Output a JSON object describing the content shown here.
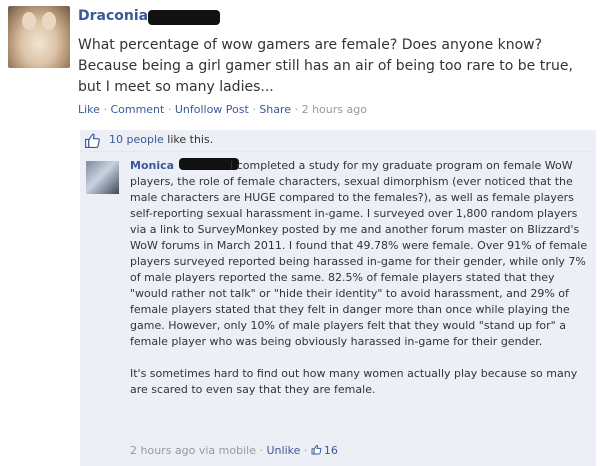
{
  "post": {
    "author": "Draconia",
    "text": "What percentage of wow gamers are female? Does anyone know? Because being a girl gamer still has an air of being too rare to be true, but I meet so many ladies...",
    "actions": {
      "like": "Like",
      "comment": "Comment",
      "unfollow": "Unfollow Post",
      "share": "Share",
      "time": "2 hours ago",
      "separator": "·"
    }
  },
  "likes": {
    "icon": "thumbs-up-icon",
    "count_text": "10 people",
    "suffix": " like this."
  },
  "comment": {
    "author": "Monica",
    "text": "I completed a study for my graduate program on female WoW players, the role of female characters, sexual dimorphism (ever noticed that the male characters are HUGE compared to the females?), as well as female players self-reporting sexual harassment in-game. I surveyed over 1,800 random players via a link to SurveyMonkey posted by me and another forum master on Blizzard's WoW forums in March 2011. I found that 49.78% were female. Over 91% of female players surveyed reported being harassed in-game for their gender, while only 7% of male players reported the same. 82.5% of female players stated that they \"would rather not talk\" or \"hide their identity\" to avoid harassment, and 29% of female players stated that they felt in danger more than once while playing the game. However, only 10% of male players felt that they would \"stand up for\" a female player who was being obviously harassed in-game for their gender.",
    "text2": "It's sometimes hard to find out how many women actually play because so many are scared to even say that they are female.",
    "time": "2 hours ago via mobile",
    "separator": "·",
    "unlike": "Unlike",
    "like_count": "16"
  },
  "colors": {
    "link": "#3b5998",
    "comment_bg": "#eceff5",
    "muted": "#999999",
    "text": "#333333"
  }
}
